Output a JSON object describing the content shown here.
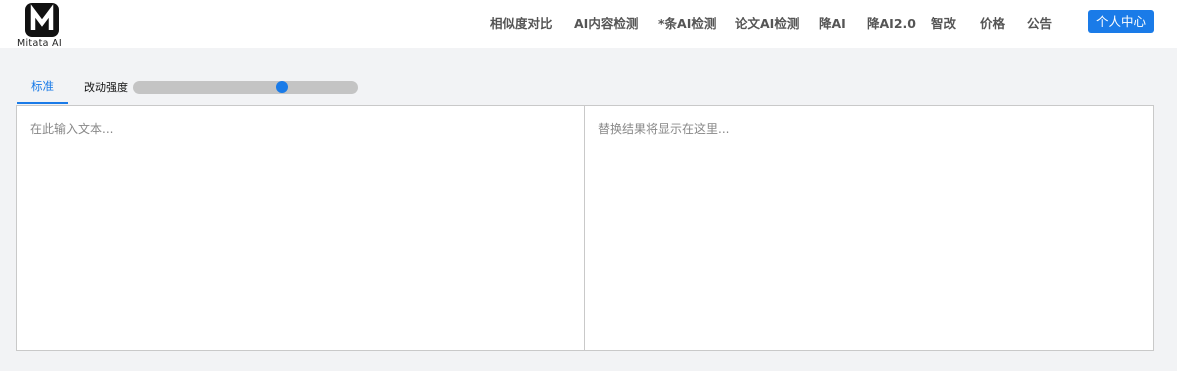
{
  "logo": {
    "text": "Mitata AI"
  },
  "nav": [
    {
      "label": "相似度对比"
    },
    {
      "label": "AI内容检测"
    },
    {
      "label": "*条AI检测"
    },
    {
      "label": "论文AI检测"
    },
    {
      "label": "降AI"
    },
    {
      "label": "降AI2.0"
    },
    {
      "label": "智改"
    },
    {
      "label": "价格"
    },
    {
      "label": "公告"
    }
  ],
  "user_center": "个人中心",
  "tab": {
    "label": "标准"
  },
  "strength": {
    "label": "改动强度",
    "value_fraction": 0.66
  },
  "editor": {
    "input_placeholder": "在此输入文本...",
    "output_placeholder": "替换结果将显示在这里..."
  },
  "colors": {
    "accent": "#1a7be8",
    "background": "#f2f3f5"
  }
}
